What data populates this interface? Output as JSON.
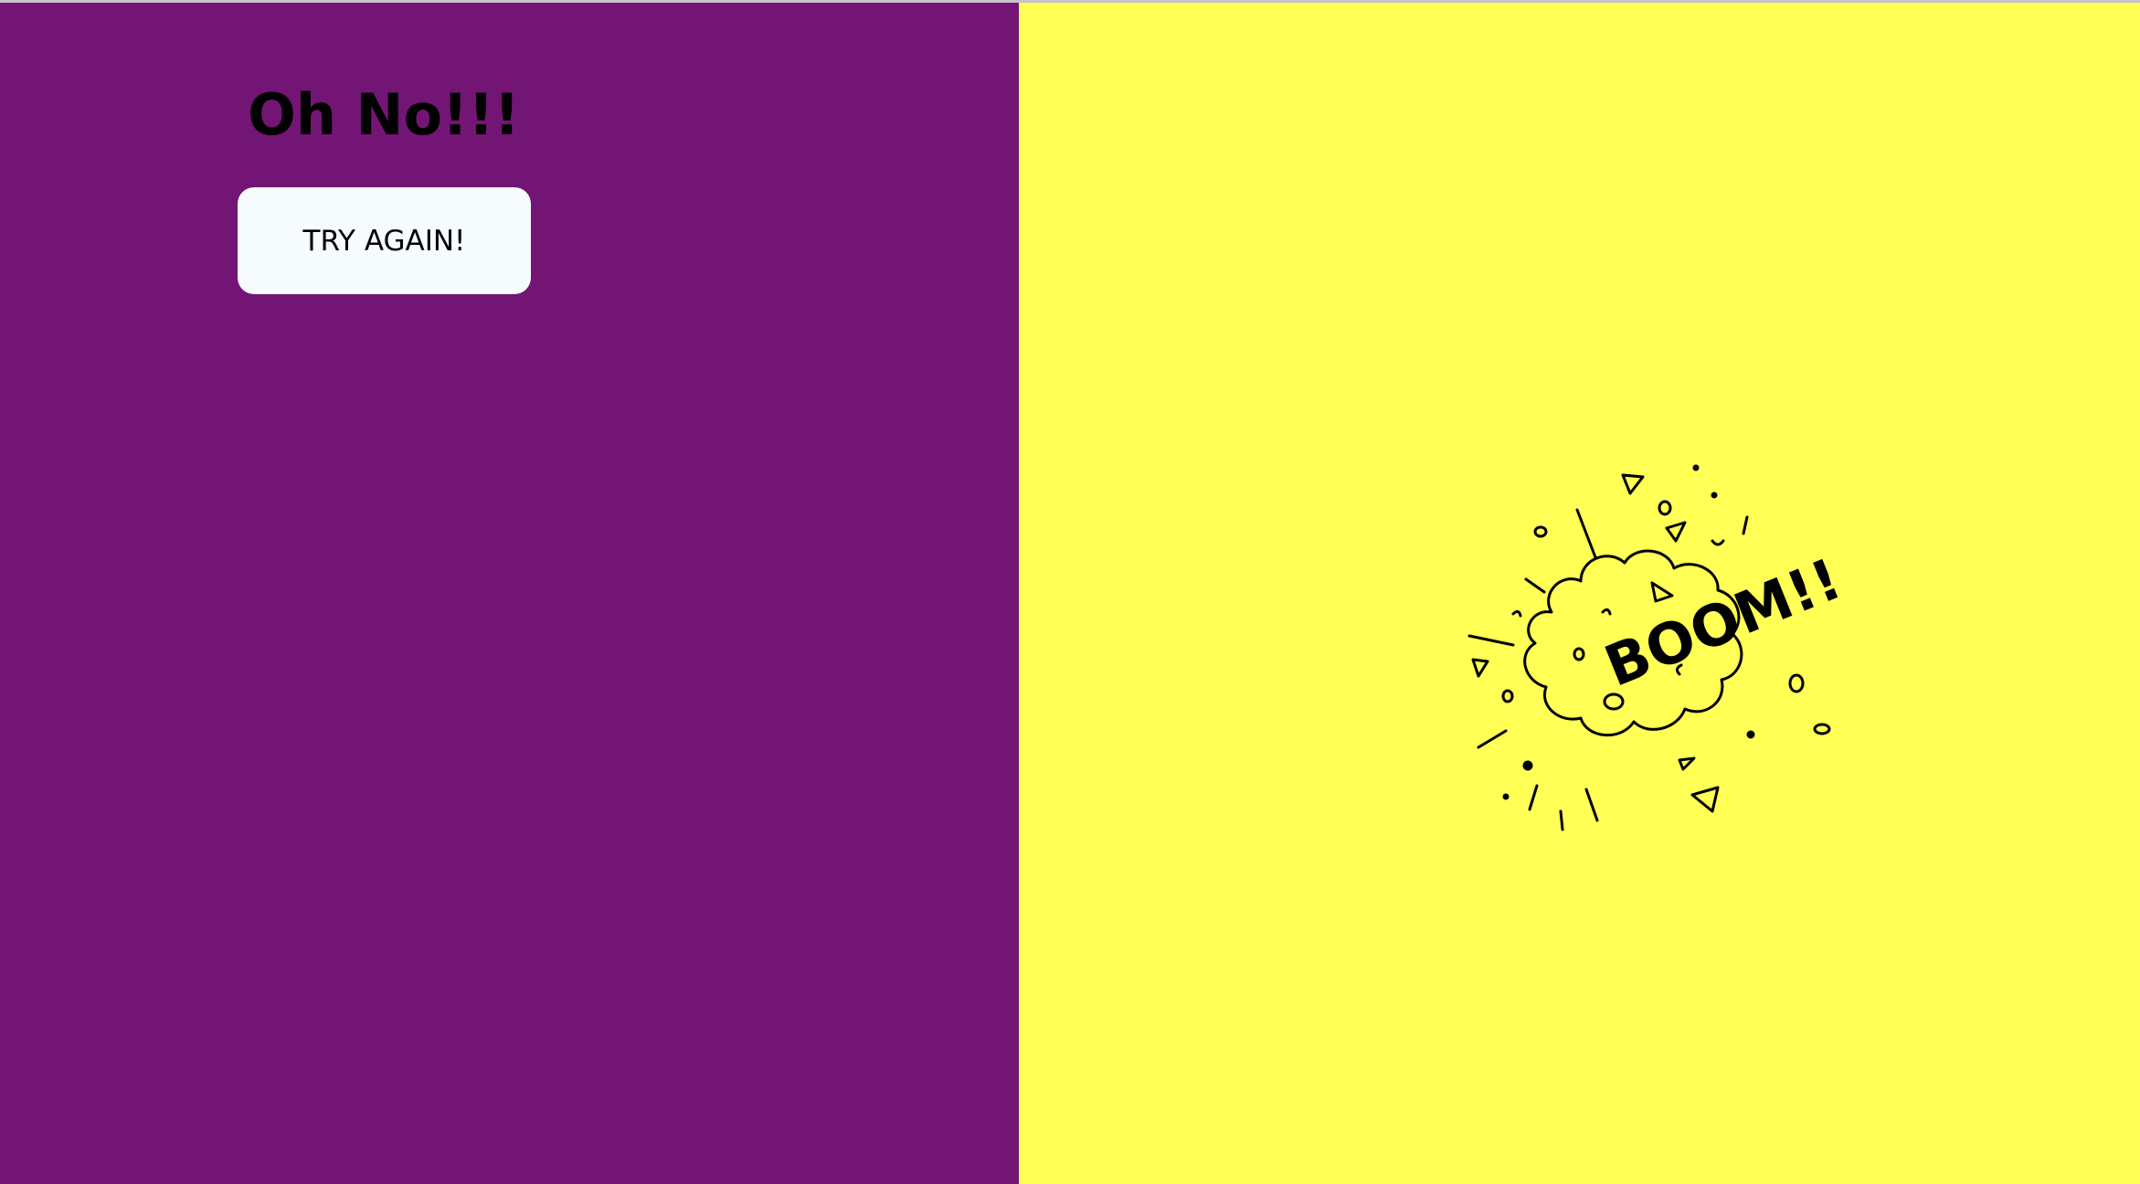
{
  "game": {
    "title": "Oh No!!!",
    "retry_label": "TRY AGAIN!",
    "explosion_text": "BOOM!!"
  },
  "colors": {
    "left_panel": "#731575",
    "right_panel": "#ffff55",
    "button": "#f6fcfd",
    "text": "#000000"
  },
  "icons": {
    "explosion": "explosion-boom-doodle"
  }
}
